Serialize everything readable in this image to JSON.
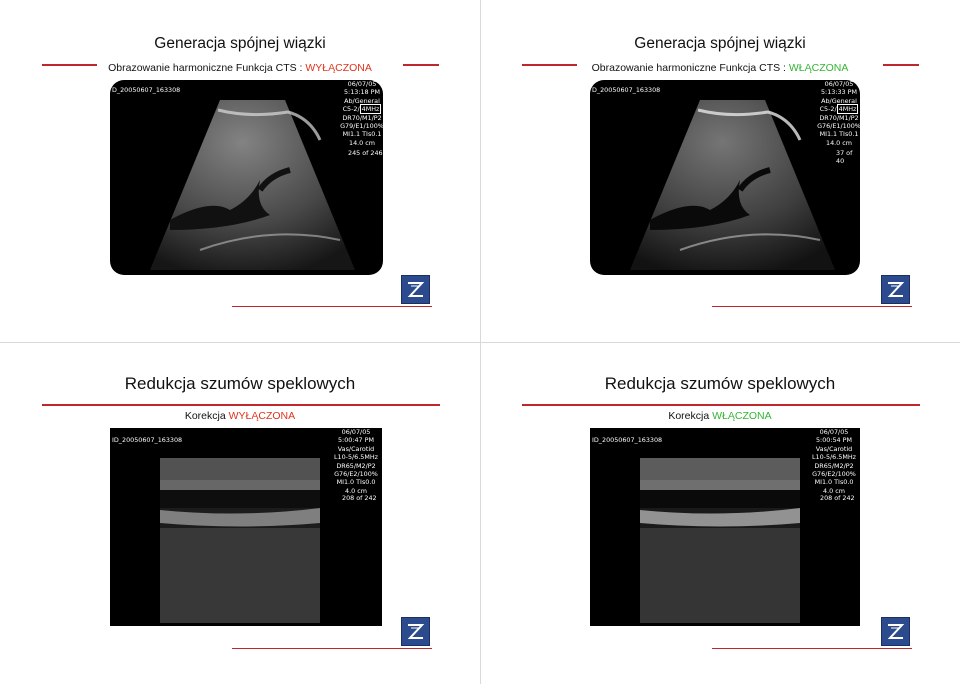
{
  "slides": [
    {
      "title": "Generacja spójnej wiązki",
      "subtitle_prefix": "Obrazowanie harmoniczne Funkcja CTS : ",
      "subtitle_state": "WYŁĄCZONA",
      "state_color": "#e0331c",
      "us": {
        "patient_id": "D_20050607_163308",
        "date": "06/07/05",
        "time": "5:13:18 PM",
        "preset": "Ab/General",
        "probe_prefix": "C5-2/",
        "probe_freq": "4MHz",
        "dr": "DR70/M1/P2",
        "gain": "G79/E1/100%",
        "mi": "MI1.1  TIs0.1",
        "depth": "14.0 cm",
        "frames": "245 of 246"
      }
    },
    {
      "title": "Generacja spójnej wiązki",
      "subtitle_prefix": "Obrazowanie harmoniczne Funkcja CTS : ",
      "subtitle_state": "WŁĄCZONA",
      "state_color": "#33b533",
      "us": {
        "patient_id": "D_20050607_163308",
        "date": "06/07/05",
        "time": "5:13:33 PM",
        "preset": "Ab/General",
        "probe_prefix": "C5-2/",
        "probe_freq": "4MHz",
        "dr": "DR70/M1/P2",
        "gain": "G76/E1/100%",
        "mi": "MI1.1  TIs0.1",
        "depth": "14.0 cm",
        "frames": "37 of 40"
      }
    },
    {
      "title": "Redukcja szumów speklowych",
      "subtitle_prefix": "Korekcja ",
      "subtitle_state": "WYŁĄCZONA",
      "state_color": "#e0331c",
      "us": {
        "patient_id": "ID_20050607_163308",
        "date": "06/07/05",
        "time": "5:00:47 PM",
        "preset": "Vas/Carotid",
        "probe": "L10-5/6.5MHz",
        "dr": "DR65/M2/P2",
        "gain": "G76/E2/100%",
        "mi": "MI1.0  TIs0.0",
        "depth": "4.0 cm",
        "frames": "208 of 242"
      }
    },
    {
      "title": "Redukcja szumów speklowych",
      "subtitle_prefix": "Korekcja ",
      "subtitle_state": "WŁĄCZONA",
      "state_color": "#33b533",
      "us": {
        "patient_id": "ID_20050607_163308",
        "date": "06/07/05",
        "time": "5:00:54 PM",
        "preset": "Vas/Carotid",
        "probe": "L10-5/6.5MHz",
        "dr": "DR65/M2/P2",
        "gain": "G76/E2/100%",
        "mi": "MI1.0  TIs0.0",
        "depth": "4.0 cm",
        "frames": "208 of 242"
      }
    }
  ],
  "logo_icon": "zz-logo-icon",
  "accent_rule_color": "#c0272d"
}
